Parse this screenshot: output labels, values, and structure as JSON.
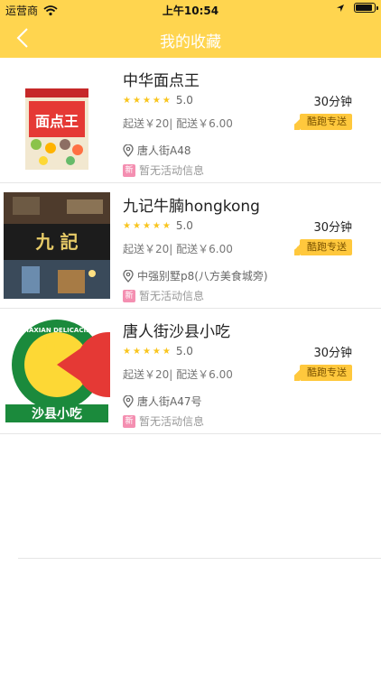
{
  "status": {
    "carrier": "运营商",
    "time": "上午10:54"
  },
  "nav": {
    "title": "我的收藏"
  },
  "shops": [
    {
      "name": "中华面点王",
      "rating": "5.0",
      "time": "30分钟",
      "fees": "起送￥20| 配送￥6.00",
      "badge": "酷跑专送",
      "address": "唐人街A48",
      "promo_tag": "新",
      "promo": "暂无活动信息",
      "logo_text": "面点王"
    },
    {
      "name": "九记牛腩hongkong",
      "rating": "5.0",
      "time": "30分钟",
      "fees": "起送￥20| 配送￥6.00",
      "badge": "酷跑专送",
      "address": "中强别墅p8(八方美食城旁)",
      "promo_tag": "新",
      "promo": "暂无活动信息",
      "logo_text": "九 記"
    },
    {
      "name": "唐人街沙县小吃",
      "rating": "5.0",
      "time": "30分钟",
      "fees": "起送￥20| 配送￥6.00",
      "badge": "酷跑专送",
      "address": "唐人街A47号",
      "promo_tag": "新",
      "promo": "暂无活动信息",
      "logo_text": "沙县小吃",
      "logo_arc": "SHAXIAN DELICACIES"
    }
  ],
  "colors": {
    "header": "#ffd54f",
    "star": "#f9c51e",
    "badge": "#ffc83d"
  }
}
